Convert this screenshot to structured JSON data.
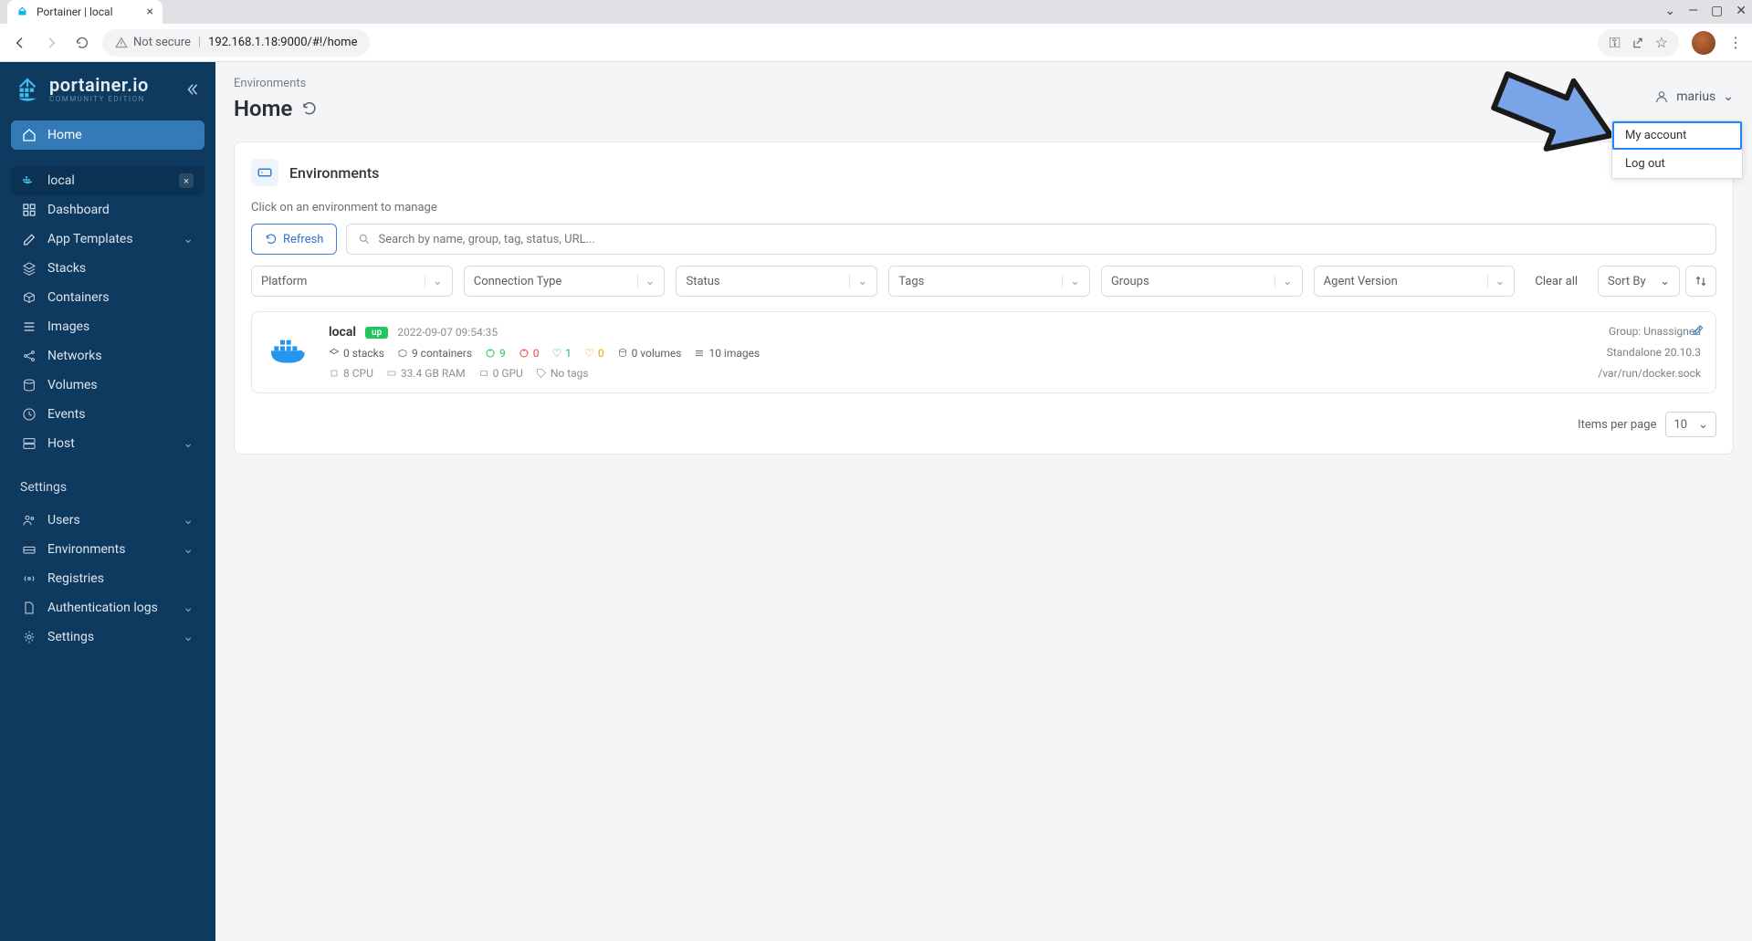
{
  "browser": {
    "tab_title": "Portainer | local",
    "not_secure_label": "Not secure",
    "url": "192.168.1.18:9000/#!/home"
  },
  "brand": {
    "name": "portainer.io",
    "edition": "COMMUNITY EDITION"
  },
  "sidebar": {
    "home": "Home",
    "env_name": "local",
    "items": [
      {
        "label": "Dashboard"
      },
      {
        "label": "App Templates",
        "expandable": true
      },
      {
        "label": "Stacks"
      },
      {
        "label": "Containers"
      },
      {
        "label": "Images"
      },
      {
        "label": "Networks"
      },
      {
        "label": "Volumes"
      },
      {
        "label": "Events"
      },
      {
        "label": "Host",
        "expandable": true
      }
    ],
    "settings_header": "Settings",
    "settings_items": [
      {
        "label": "Users",
        "expandable": true
      },
      {
        "label": "Environments",
        "expandable": true
      },
      {
        "label": "Registries"
      },
      {
        "label": "Authentication logs",
        "expandable": true
      },
      {
        "label": "Settings",
        "expandable": true
      }
    ]
  },
  "header": {
    "breadcrumb": "Environments",
    "title": "Home",
    "username": "marius"
  },
  "user_menu": {
    "my_account": "My account",
    "log_out": "Log out"
  },
  "panel": {
    "title": "Environments",
    "hint": "Click on an environment to manage",
    "refresh_label": "Refresh",
    "search_placeholder": "Search by name, group, tag, status, URL...",
    "filters": {
      "platform": "Platform",
      "connection": "Connection Type",
      "status": "Status",
      "tags": "Tags",
      "groups": "Groups",
      "agent": "Agent Version",
      "clear": "Clear all",
      "sort": "Sort By"
    }
  },
  "env": {
    "name": "local",
    "status": "up",
    "timestamp": "2022-09-07 09:54:35",
    "stacks": "0 stacks",
    "containers": "9 containers",
    "running": "9",
    "stopped": "0",
    "healthy": "1",
    "unhealthy": "0",
    "volumes": "0 volumes",
    "images": "10 images",
    "cpu": "8 CPU",
    "ram": "33.4 GB RAM",
    "gpu": "0 GPU",
    "tags": "No tags",
    "group": "Group: Unassigned",
    "version": "Standalone 20.10.3",
    "endpoint": "/var/run/docker.sock"
  },
  "pager": {
    "label": "Items per page",
    "value": "10"
  }
}
